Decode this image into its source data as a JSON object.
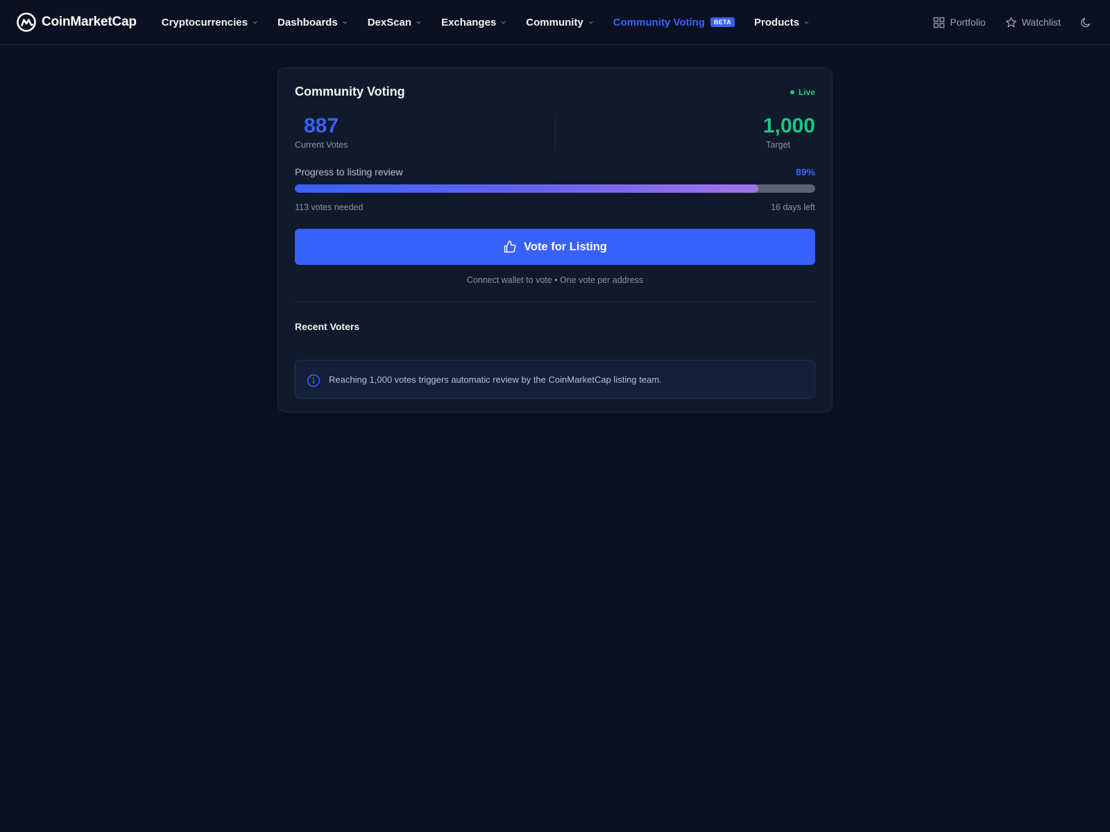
{
  "brand": {
    "name": "CoinMarketCap",
    "accent": "#3861fb",
    "green": "#16c784"
  },
  "nav": {
    "items": [
      {
        "label": "Cryptocurrencies",
        "has_dropdown": true
      },
      {
        "label": "Dashboards",
        "has_dropdown": true
      },
      {
        "label": "DexScan",
        "has_dropdown": true
      },
      {
        "label": "Exchanges",
        "has_dropdown": true
      },
      {
        "label": "Community",
        "has_dropdown": true
      },
      {
        "label": "Community Voting",
        "badge": "BETA",
        "active": true
      },
      {
        "label": "Products",
        "has_dropdown": true
      }
    ],
    "right": {
      "portfolio": {
        "label": "Portfolio",
        "icon": "grid-icon"
      },
      "watchlist": {
        "label": "Watchlist",
        "icon": "star-icon"
      },
      "theme": {
        "icon": "moon-icon"
      }
    }
  },
  "card": {
    "title": "Community Voting",
    "status": "Live",
    "current_votes": {
      "value": "887",
      "label": "Current Votes"
    },
    "target": {
      "value": "1,000",
      "label": "Target"
    },
    "progress": {
      "label": "Progress to listing review",
      "percent_text": "89%",
      "fraction": 0.89,
      "votes_needed": "113 votes needed",
      "time_left": "16 days left"
    },
    "vote_button": {
      "label": "Vote for Listing",
      "icon": "thumbs-up-icon"
    },
    "vote_note": "Connect wallet to vote • One vote per address",
    "recent_voters_title": "Recent Voters",
    "info": {
      "icon": "info-icon",
      "text": "Reaching 1,000 votes triggers automatic review by the CoinMarketCap listing team."
    }
  }
}
